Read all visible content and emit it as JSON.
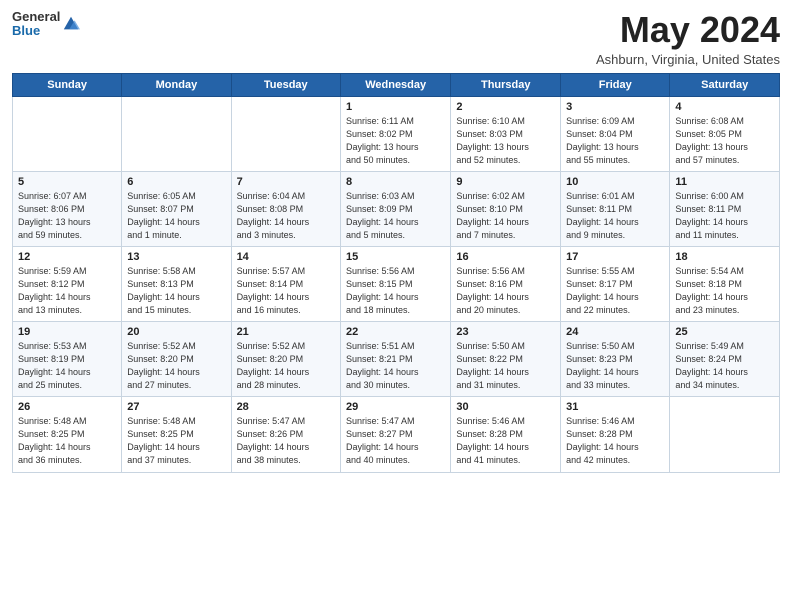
{
  "header": {
    "logo_general": "General",
    "logo_blue": "Blue",
    "title": "May 2024",
    "location": "Ashburn, Virginia, United States"
  },
  "days_of_week": [
    "Sunday",
    "Monday",
    "Tuesday",
    "Wednesday",
    "Thursday",
    "Friday",
    "Saturday"
  ],
  "weeks": [
    [
      {
        "day": "",
        "info": ""
      },
      {
        "day": "",
        "info": ""
      },
      {
        "day": "",
        "info": ""
      },
      {
        "day": "1",
        "info": "Sunrise: 6:11 AM\nSunset: 8:02 PM\nDaylight: 13 hours\nand 50 minutes."
      },
      {
        "day": "2",
        "info": "Sunrise: 6:10 AM\nSunset: 8:03 PM\nDaylight: 13 hours\nand 52 minutes."
      },
      {
        "day": "3",
        "info": "Sunrise: 6:09 AM\nSunset: 8:04 PM\nDaylight: 13 hours\nand 55 minutes."
      },
      {
        "day": "4",
        "info": "Sunrise: 6:08 AM\nSunset: 8:05 PM\nDaylight: 13 hours\nand 57 minutes."
      }
    ],
    [
      {
        "day": "5",
        "info": "Sunrise: 6:07 AM\nSunset: 8:06 PM\nDaylight: 13 hours\nand 59 minutes."
      },
      {
        "day": "6",
        "info": "Sunrise: 6:05 AM\nSunset: 8:07 PM\nDaylight: 14 hours\nand 1 minute."
      },
      {
        "day": "7",
        "info": "Sunrise: 6:04 AM\nSunset: 8:08 PM\nDaylight: 14 hours\nand 3 minutes."
      },
      {
        "day": "8",
        "info": "Sunrise: 6:03 AM\nSunset: 8:09 PM\nDaylight: 14 hours\nand 5 minutes."
      },
      {
        "day": "9",
        "info": "Sunrise: 6:02 AM\nSunset: 8:10 PM\nDaylight: 14 hours\nand 7 minutes."
      },
      {
        "day": "10",
        "info": "Sunrise: 6:01 AM\nSunset: 8:11 PM\nDaylight: 14 hours\nand 9 minutes."
      },
      {
        "day": "11",
        "info": "Sunrise: 6:00 AM\nSunset: 8:11 PM\nDaylight: 14 hours\nand 11 minutes."
      }
    ],
    [
      {
        "day": "12",
        "info": "Sunrise: 5:59 AM\nSunset: 8:12 PM\nDaylight: 14 hours\nand 13 minutes."
      },
      {
        "day": "13",
        "info": "Sunrise: 5:58 AM\nSunset: 8:13 PM\nDaylight: 14 hours\nand 15 minutes."
      },
      {
        "day": "14",
        "info": "Sunrise: 5:57 AM\nSunset: 8:14 PM\nDaylight: 14 hours\nand 16 minutes."
      },
      {
        "day": "15",
        "info": "Sunrise: 5:56 AM\nSunset: 8:15 PM\nDaylight: 14 hours\nand 18 minutes."
      },
      {
        "day": "16",
        "info": "Sunrise: 5:56 AM\nSunset: 8:16 PM\nDaylight: 14 hours\nand 20 minutes."
      },
      {
        "day": "17",
        "info": "Sunrise: 5:55 AM\nSunset: 8:17 PM\nDaylight: 14 hours\nand 22 minutes."
      },
      {
        "day": "18",
        "info": "Sunrise: 5:54 AM\nSunset: 8:18 PM\nDaylight: 14 hours\nand 23 minutes."
      }
    ],
    [
      {
        "day": "19",
        "info": "Sunrise: 5:53 AM\nSunset: 8:19 PM\nDaylight: 14 hours\nand 25 minutes."
      },
      {
        "day": "20",
        "info": "Sunrise: 5:52 AM\nSunset: 8:20 PM\nDaylight: 14 hours\nand 27 minutes."
      },
      {
        "day": "21",
        "info": "Sunrise: 5:52 AM\nSunset: 8:20 PM\nDaylight: 14 hours\nand 28 minutes."
      },
      {
        "day": "22",
        "info": "Sunrise: 5:51 AM\nSunset: 8:21 PM\nDaylight: 14 hours\nand 30 minutes."
      },
      {
        "day": "23",
        "info": "Sunrise: 5:50 AM\nSunset: 8:22 PM\nDaylight: 14 hours\nand 31 minutes."
      },
      {
        "day": "24",
        "info": "Sunrise: 5:50 AM\nSunset: 8:23 PM\nDaylight: 14 hours\nand 33 minutes."
      },
      {
        "day": "25",
        "info": "Sunrise: 5:49 AM\nSunset: 8:24 PM\nDaylight: 14 hours\nand 34 minutes."
      }
    ],
    [
      {
        "day": "26",
        "info": "Sunrise: 5:48 AM\nSunset: 8:25 PM\nDaylight: 14 hours\nand 36 minutes."
      },
      {
        "day": "27",
        "info": "Sunrise: 5:48 AM\nSunset: 8:25 PM\nDaylight: 14 hours\nand 37 minutes."
      },
      {
        "day": "28",
        "info": "Sunrise: 5:47 AM\nSunset: 8:26 PM\nDaylight: 14 hours\nand 38 minutes."
      },
      {
        "day": "29",
        "info": "Sunrise: 5:47 AM\nSunset: 8:27 PM\nDaylight: 14 hours\nand 40 minutes."
      },
      {
        "day": "30",
        "info": "Sunrise: 5:46 AM\nSunset: 8:28 PM\nDaylight: 14 hours\nand 41 minutes."
      },
      {
        "day": "31",
        "info": "Sunrise: 5:46 AM\nSunset: 8:28 PM\nDaylight: 14 hours\nand 42 minutes."
      },
      {
        "day": "",
        "info": ""
      }
    ]
  ]
}
